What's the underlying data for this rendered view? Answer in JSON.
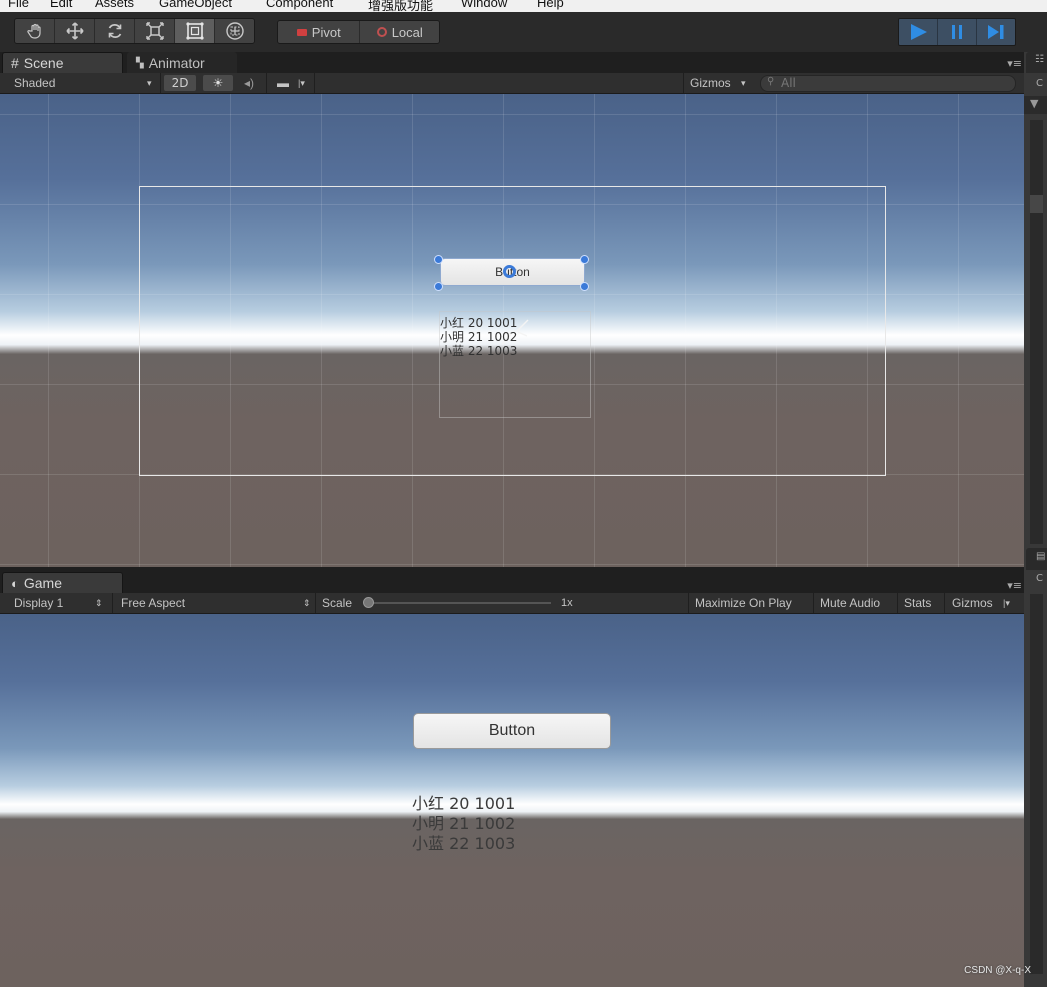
{
  "menu": [
    "File",
    "Edit",
    "Assets",
    "GameObject",
    "Component",
    "增强版功能",
    "Window",
    "Help"
  ],
  "toolbar": {
    "tools": [
      "hand-tool",
      "move-tool",
      "rotate-tool",
      "scale-tool",
      "rect-tool",
      "transform-tool"
    ],
    "active_tool": "rect-tool",
    "pivot_label": "Pivot",
    "local_label": "Local",
    "play_controls": [
      "play",
      "pause",
      "step"
    ],
    "accent_color": "#2f8de4"
  },
  "scene": {
    "tab_label": "Scene",
    "animator_tab_label": "Animator",
    "shading_mode": "Shaded",
    "mode_2d": "2D",
    "gizmos_label": "Gizmos",
    "search_placeholder": "All",
    "button_text": "Button",
    "list_lines": [
      "小红 20 1001",
      "小明 21 1002",
      "小蓝 22 1003"
    ]
  },
  "game": {
    "tab_label": "Game",
    "display": "Display 1",
    "aspect": "Free Aspect",
    "scale_label": "Scale",
    "scale_value": "1x",
    "maximize_label": "Maximize On Play",
    "mute_label": "Mute Audio",
    "stats_label": "Stats",
    "gizmos_label": "Gizmos",
    "button_text": "Button",
    "list_lines": [
      "小红 20 1001",
      "小明 21 1002",
      "小蓝 22 1003"
    ]
  },
  "watermark": "CSDN @X-q-X"
}
